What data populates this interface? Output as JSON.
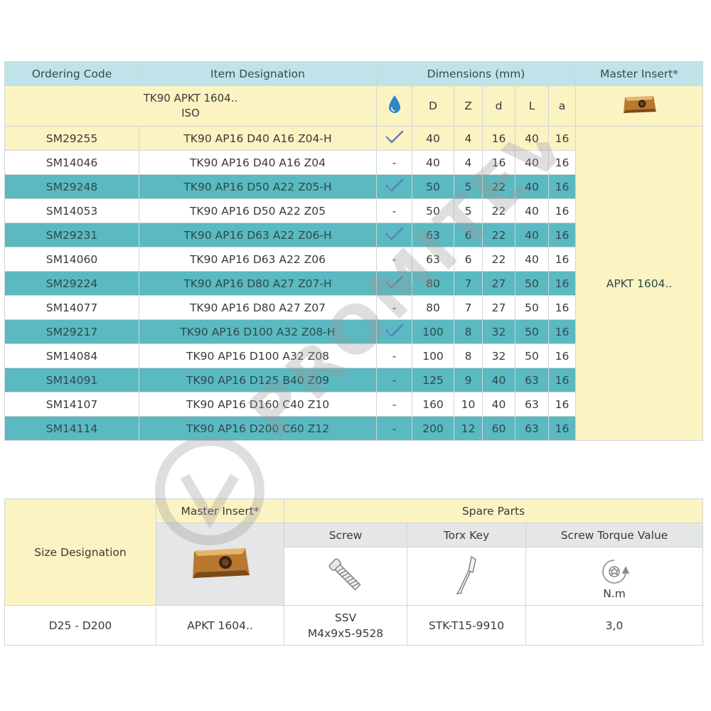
{
  "table1": {
    "headers": {
      "ordering_code": "Ordering Code",
      "item_designation": "Item Designation",
      "dimensions": "Dimensions (mm)",
      "master_insert": "Master Insert*"
    },
    "subheader": {
      "line1": "TK90 APKT 1604..",
      "line2": "ISO",
      "coolant_icon": "water-drop-icon",
      "cols": [
        "D",
        "Z",
        "d",
        "L",
        "a"
      ]
    },
    "master_insert_value": "APKT 1604..",
    "rows": [
      {
        "code": "SM29255",
        "item": "TK90 AP16 D40 A16 Z04-H",
        "coolant": "✓",
        "D": "40",
        "Z": "4",
        "d": "16",
        "L": "40",
        "a": "16"
      },
      {
        "code": "SM14046",
        "item": "TK90 AP16 D40 A16 Z04",
        "coolant": "-",
        "D": "40",
        "Z": "4",
        "d": "16",
        "L": "40",
        "a": "16"
      },
      {
        "code": "SM29248",
        "item": "TK90 AP16 D50 A22 Z05-H",
        "coolant": "✓",
        "D": "50",
        "Z": "5",
        "d": "22",
        "L": "40",
        "a": "16"
      },
      {
        "code": "SM14053",
        "item": "TK90 AP16 D50 A22 Z05",
        "coolant": "-",
        "D": "50",
        "Z": "5",
        "d": "22",
        "L": "40",
        "a": "16"
      },
      {
        "code": "SM29231",
        "item": "TK90 AP16 D63 A22 Z06-H",
        "coolant": "✓",
        "D": "63",
        "Z": "6",
        "d": "22",
        "L": "40",
        "a": "16"
      },
      {
        "code": "SM14060",
        "item": "TK90 AP16 D63 A22 Z06",
        "coolant": "-",
        "D": "63",
        "Z": "6",
        "d": "22",
        "L": "40",
        "a": "16"
      },
      {
        "code": "SM29224",
        "item": "TK90 AP16 D80 A27 Z07-H",
        "coolant": "✓",
        "D": "80",
        "Z": "7",
        "d": "27",
        "L": "50",
        "a": "16"
      },
      {
        "code": "SM14077",
        "item": "TK90 AP16 D80 A27 Z07",
        "coolant": "-",
        "D": "80",
        "Z": "7",
        "d": "27",
        "L": "50",
        "a": "16"
      },
      {
        "code": "SM29217",
        "item": "TK90 AP16 D100 A32 Z08-H",
        "coolant": "✓",
        "D": "100",
        "Z": "8",
        "d": "32",
        "L": "50",
        "a": "16"
      },
      {
        "code": "SM14084",
        "item": "TK90 AP16 D100 A32 Z08",
        "coolant": "-",
        "D": "100",
        "Z": "8",
        "d": "32",
        "L": "50",
        "a": "16"
      },
      {
        "code": "SM14091",
        "item": "TK90 AP16 D125 B40 Z09",
        "coolant": "-",
        "D": "125",
        "Z": "9",
        "d": "40",
        "L": "63",
        "a": "16"
      },
      {
        "code": "SM14107",
        "item": "TK90 AP16 D160 C40 Z10",
        "coolant": "-",
        "D": "160",
        "Z": "10",
        "d": "40",
        "L": "63",
        "a": "16"
      },
      {
        "code": "SM14114",
        "item": "TK90 AP16 D200 C60 Z12",
        "coolant": "-",
        "D": "200",
        "Z": "12",
        "d": "60",
        "L": "63",
        "a": "16"
      }
    ]
  },
  "table2": {
    "size_designation_label": "Size Designation",
    "master_insert_label": "Master Insert*",
    "spare_parts_label": "Spare Parts",
    "screw_label": "Screw",
    "torx_key_label": "Torx Key",
    "torque_label": "Screw Torque Value",
    "torque_unit": "N.m",
    "row": {
      "size": "D25 - D200",
      "insert": "APKT 1604..",
      "screw_line1": "SSV",
      "screw_line2": "M4x9x5-9528",
      "torx_key": "STK-T15-9910",
      "torque": "3,0"
    }
  },
  "watermark_text": "PROMITEV",
  "colors": {
    "header_light_teal": "#bfe3e8",
    "teal_row": "#5ab9c1",
    "yellow": "#fbf3c2",
    "insert_gold": "#c98a3a"
  }
}
